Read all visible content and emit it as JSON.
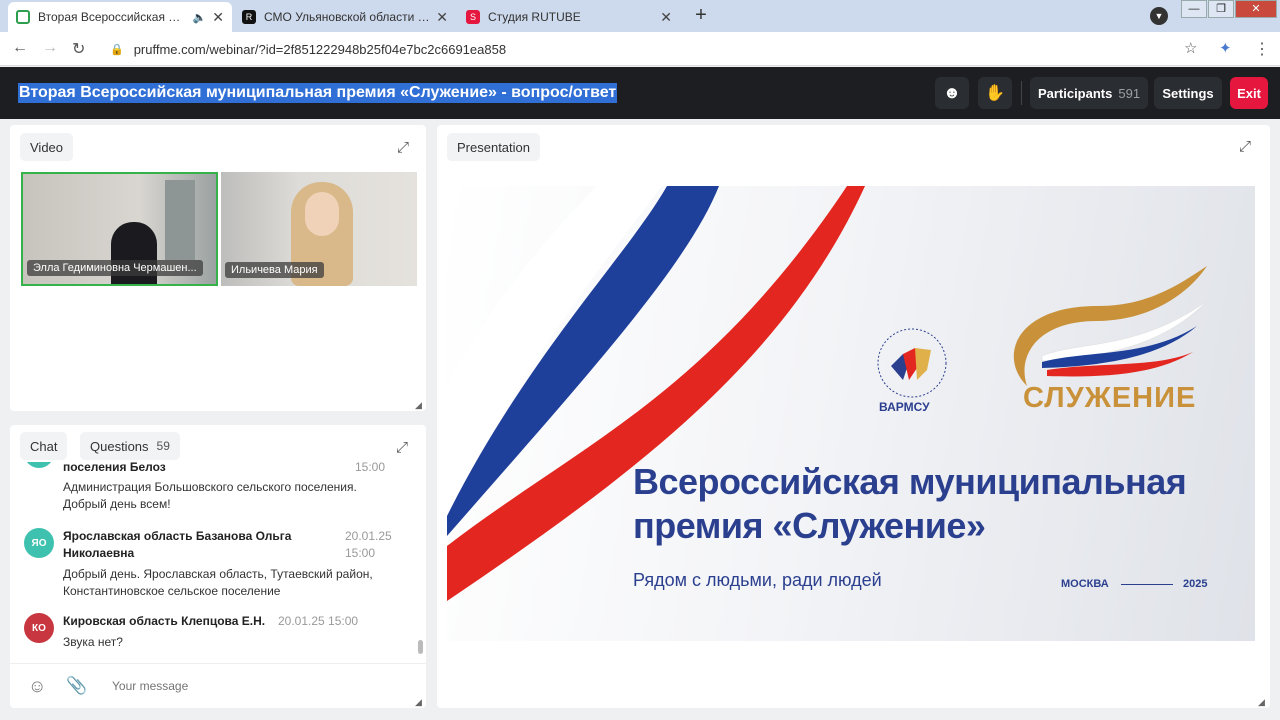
{
  "browser": {
    "tabs": [
      {
        "title": "Вторая Всероссийская муни",
        "icon": "video-camera-icon",
        "color": "#2e9e4f",
        "active": true
      },
      {
        "title": "СМО Ульяновской области на R",
        "icon": "rutube-icon",
        "color": "#111111",
        "active": false
      },
      {
        "title": "Студия RUTUBE",
        "icon": "rutube-studio-icon",
        "color": "#e5173f",
        "active": false
      }
    ],
    "url": "pruffme.com/webinar/?id=2f851222948b25f04e7bc2c6691ea858"
  },
  "header": {
    "title": "Вторая Всероссийская муниципальная премия «Служение» - вопрос/ответ",
    "participants_label": "Participants",
    "participants_count": "591",
    "settings_label": "Settings",
    "exit_label": "Exit"
  },
  "video_panel": {
    "tab_label": "Video",
    "tiles": [
      {
        "name": "Элла Гедиминовна Чермашен..."
      },
      {
        "name": "Ильичева Мария"
      }
    ]
  },
  "chat_panel": {
    "tab_chat": "Chat",
    "tab_questions": "Questions",
    "questions_count": "59",
    "messages": [
      {
        "author": "поселения Белоз",
        "time": "15:00",
        "text": "Администрация Большовского сельского поселения.",
        "text2": "Добрый день всем!"
      },
      {
        "initials": "ЯО",
        "author": "Ярославская область Базанова Ольга",
        "author2": "Николаевна",
        "time": "20.01.25",
        "time2": "15:00",
        "text": "Добрый день. Ярославская область, Тутаевский район,",
        "text2": "Константиновское сельское поселение",
        "color": "#3fc1b0"
      },
      {
        "initials": "КО",
        "author": "Кировская область Клепцова Е.Н.",
        "time": "20.01.25 15:00",
        "text": "Звука нет?",
        "color": "#c8363f"
      }
    ],
    "input_placeholder": "Your message"
  },
  "presentation_panel": {
    "tab_label": "Presentation",
    "slide": {
      "title_line1": "Всероссийская муниципальная",
      "title_line2": "премия «Служение»",
      "subtitle": "Рядом с людьми, ради людей",
      "city": "МОСКВА",
      "year": "2025",
      "logo_left": "ВАРМСУ",
      "logo_right": "СЛУЖЕНИЕ"
    }
  }
}
